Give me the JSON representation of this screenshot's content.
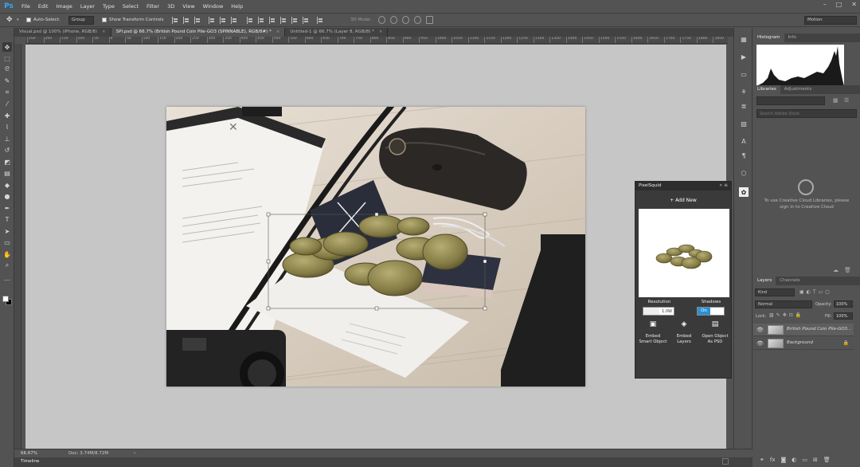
{
  "menubar": {
    "logo": "Ps",
    "items": [
      "File",
      "Edit",
      "Image",
      "Layer",
      "Type",
      "Select",
      "Filter",
      "3D",
      "View",
      "Window",
      "Help"
    ]
  },
  "options": {
    "auto_select": "Auto-Select:",
    "auto_select_value": "Group",
    "show_transform": "Show Transform Controls",
    "mode_3d": "3D Mode:",
    "workspace": "Motion"
  },
  "tabs": [
    {
      "label": "Visual.psd @ 100% (iPhone, RGB/8)",
      "active": false
    },
    {
      "label": "SPI.psd @ 66.7% (British Pound Coin Pile-GO3 (SPINNABLE), RGB/8#) *",
      "active": true
    },
    {
      "label": "Untitled-1 @ 66.7% (Layer 8, RGB/8) *",
      "active": false
    }
  ],
  "ruler_top": [
    "250",
    "200",
    "150",
    "100",
    "50",
    "0",
    "50",
    "100",
    "150",
    "200",
    "250",
    "300",
    "350",
    "400",
    "450",
    "500",
    "550",
    "600",
    "650",
    "700",
    "750",
    "800",
    "850",
    "900",
    "950",
    "1000",
    "1050",
    "1100",
    "1150",
    "1200",
    "1250",
    "1300",
    "1350",
    "1400",
    "1450",
    "1500",
    "1550",
    "1600",
    "1650",
    "1700",
    "1750",
    "1800",
    "1850"
  ],
  "status": {
    "zoom": "66.67%",
    "doc": "Doc: 3.74M/8.72M"
  },
  "timeline": {
    "label": "Timeline"
  },
  "panels": {
    "histogram_tabs": [
      "Histogram",
      "Info"
    ],
    "libraries_tabs": [
      "Libraries",
      "Adjustments"
    ],
    "lib_search_placeholder": "Search Adobe Stock",
    "cc_message": "To use Creative Cloud Libraries, please sign in to Creative Cloud",
    "layers_tabs": [
      "Layers",
      "Channels"
    ],
    "kind": "Kind",
    "blend_mode": "Normal",
    "opacity_label": "Opacity:",
    "opacity_value": "100%",
    "lock_label": "Lock:",
    "fill_label": "Fill:",
    "fill_value": "100%",
    "layers": [
      {
        "name": "British Pound Coin Pile-GO3...",
        "selected": true,
        "locked": false
      },
      {
        "name": "Background",
        "selected": false,
        "locked": true
      }
    ]
  },
  "pixelsquid": {
    "title": "PixelSquid",
    "add_new": "+ Add New",
    "resolution_label": "Resolution",
    "resolution_value": "1.0W",
    "shadows_label": "Shadows",
    "shadows_value": "On",
    "actions": [
      {
        "label": "Embed Smart Object",
        "icon": "embed-smart-object-icon"
      },
      {
        "label": "Embed Layers",
        "icon": "embed-layers-icon"
      },
      {
        "label": "Open Object As PSD",
        "icon": "open-psd-icon"
      }
    ]
  },
  "colors": {
    "panel": "#535353",
    "dark": "#3a3a3a",
    "canvas": "#c6c6c6",
    "accent": "#31a8ff",
    "toggle_on": "#2c8fd6"
  }
}
